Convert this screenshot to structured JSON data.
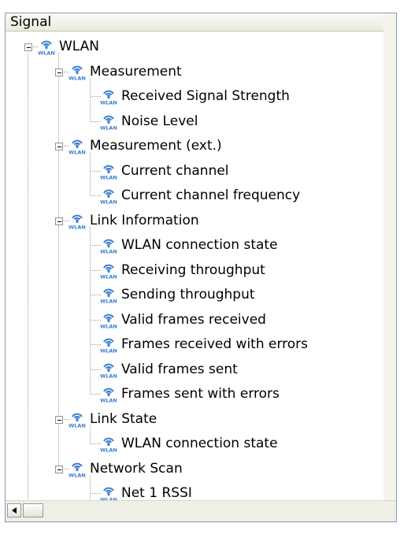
{
  "header": {
    "label": "Signal"
  },
  "tree": [
    {
      "label": "WLAN",
      "level": 0,
      "expanded": true
    },
    {
      "label": "Measurement",
      "level": 1,
      "expanded": true
    },
    {
      "label": "Received Signal Strength",
      "level": 2
    },
    {
      "label": "Noise Level",
      "level": 2
    },
    {
      "label": "Measurement (ext.)",
      "level": 1,
      "expanded": true
    },
    {
      "label": "Current channel",
      "level": 2
    },
    {
      "label": "Current channel frequency",
      "level": 2
    },
    {
      "label": "Link Information",
      "level": 1,
      "expanded": true
    },
    {
      "label": "WLAN connection state",
      "level": 2
    },
    {
      "label": "Receiving throughput",
      "level": 2
    },
    {
      "label": "Sending throughput",
      "level": 2
    },
    {
      "label": "Valid frames received",
      "level": 2
    },
    {
      "label": "Frames received with errors",
      "level": 2
    },
    {
      "label": "Valid frames sent",
      "level": 2
    },
    {
      "label": "Frames sent with errors",
      "level": 2
    },
    {
      "label": "Link State",
      "level": 1,
      "expanded": true
    },
    {
      "label": "WLAN connection state",
      "level": 2
    },
    {
      "label": "Network Scan",
      "level": 1,
      "expanded": true
    },
    {
      "label": "Net 1 RSSI",
      "level": 2
    }
  ],
  "icon": {
    "name": "wlan-icon",
    "text": "WLAN",
    "color": "#3b7fd4"
  }
}
